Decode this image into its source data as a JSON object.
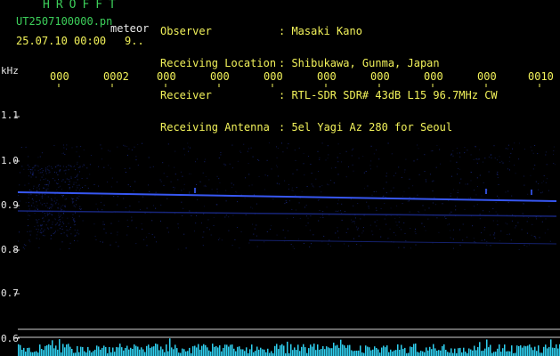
{
  "app": {
    "title": "HROFFT"
  },
  "file": {
    "name": "UT2507100000.pn",
    "type_label": "meteor",
    "timestamp": "25.07.10 00:00",
    "count": "9.."
  },
  "info": {
    "rows": [
      {
        "label": "Observer",
        "value": ": Masaki Kano"
      },
      {
        "label": "Receiving Location",
        "value": ": Shibukawa, Gunma, Japan"
      },
      {
        "label": "Receiver",
        "value": ": RTL-SDR SDR# 43dB L15 96.7MHz CW"
      },
      {
        "label": "Receiving Antenna",
        "value": ": 5el Yagi Az 280 for Seoul"
      }
    ]
  },
  "axis": {
    "unit": "kHz",
    "freq_labels": [
      "1.1",
      "1.0",
      "0.9",
      "0.8",
      "0.7",
      "0.6"
    ],
    "time_labels": [
      "000",
      "0002",
      "000",
      "000",
      "000",
      "000",
      "000",
      "000",
      "000",
      "0010"
    ]
  },
  "colors": {
    "signal": "#3a5cff",
    "noise": "#1a2a88",
    "grid": "#cfcfcf",
    "histogram": "#2fd0f0"
  }
}
